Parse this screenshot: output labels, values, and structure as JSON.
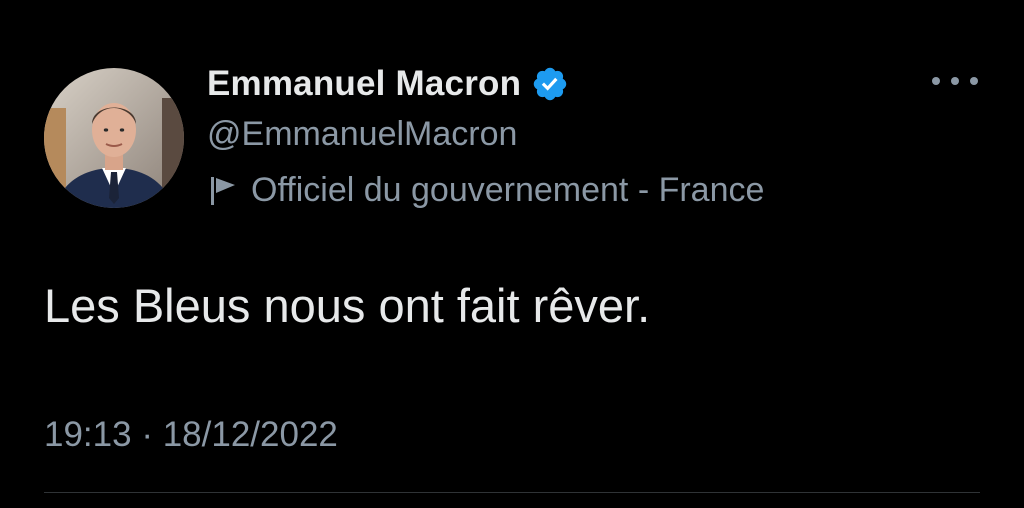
{
  "author": {
    "display_name": "Emmanuel Macron",
    "handle": "@EmmanuelMacron",
    "verified": true,
    "affiliation": "Officiel du gouvernement - France"
  },
  "tweet": {
    "text": "Les Bleus nous ont fait rêver.",
    "time": "19:13",
    "separator": "·",
    "date": "18/12/2022"
  },
  "icons": {
    "verified": "verified-badge-icon",
    "affiliation": "flag-icon",
    "more": "more-options-icon"
  },
  "colors": {
    "background": "#000000",
    "primary_text": "#e7e9ea",
    "secondary_text": "#8b98a5",
    "verified_blue": "#1d9bf0",
    "divider": "#2f3336"
  }
}
